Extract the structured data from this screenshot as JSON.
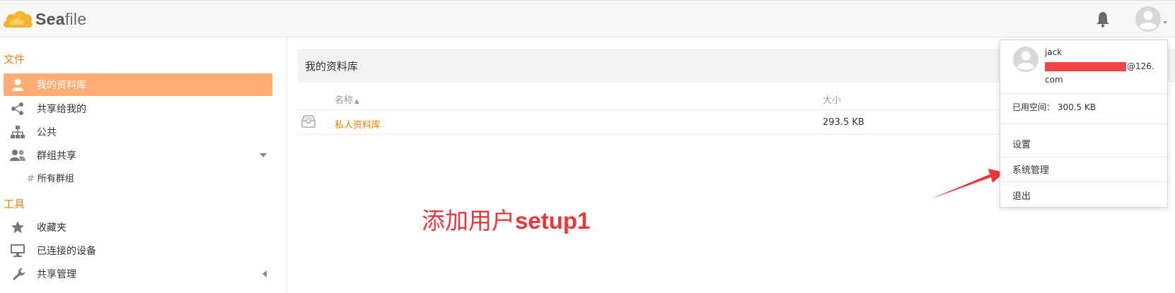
{
  "header": {
    "logo": {
      "prefix": "Sea",
      "suffix": "file"
    },
    "icons": [
      "bell-icon",
      "user-avatar-icon",
      "caret-down-icon"
    ]
  },
  "sidebar": {
    "files_title": "文件",
    "items": [
      {
        "label": "我的资料库",
        "icon": "user-icon",
        "active": true
      },
      {
        "label": "共享给我的",
        "icon": "share-icon"
      },
      {
        "label": "公共",
        "icon": "sitemap-icon"
      },
      {
        "label": "群组共享",
        "icon": "group-icon",
        "caret": "down"
      }
    ],
    "subitem": {
      "hash": "#",
      "label": "所有群组"
    },
    "tools_title": "工具",
    "tools": [
      {
        "label": "收藏夹",
        "icon": "star-icon"
      },
      {
        "label": "已连接的设备",
        "icon": "monitor-icon"
      },
      {
        "label": "共享管理",
        "icon": "wrench-icon",
        "caret": "left"
      }
    ]
  },
  "main": {
    "title": "我的资料库",
    "columns": {
      "name": "名称",
      "sort_indicator": "▲",
      "size": "大小"
    },
    "rows": [
      {
        "name": "私人资料库",
        "size": "293.5 KB",
        "icon": "library-icon"
      }
    ]
  },
  "annotation": {
    "prefix": "添加用户",
    "suffix": "setup1",
    "color": "#e8363a"
  },
  "dropdown": {
    "name": "jack",
    "email_suffix": "@126.",
    "email_line2": "com",
    "quota": "已用空间：  300.5 KB",
    "items": [
      "设置",
      "系统管理",
      "退出"
    ]
  },
  "colors": {
    "accent": "#eb8205",
    "active_bg": "#feac74",
    "annotation": "#e8363a"
  }
}
